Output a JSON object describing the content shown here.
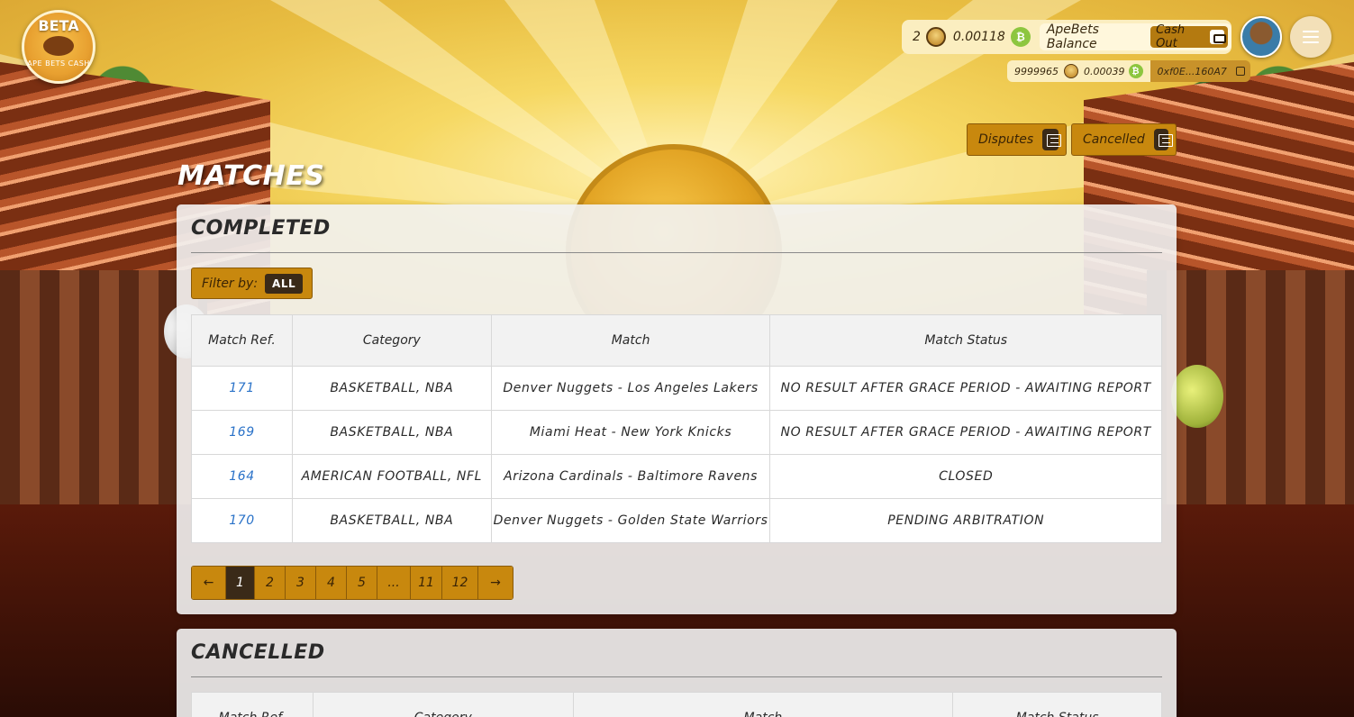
{
  "logo": {
    "beta": "BETA",
    "name": "APE BETS CASH"
  },
  "wallet": {
    "ape_count": "2",
    "btc_amount": "0.00118",
    "btc_glyph": "₿",
    "balance_label": "ApeBets Balance",
    "cashout_label": "Cash Out",
    "sub_ape_count": "9999965",
    "sub_btc_amount": "0.00039",
    "address": "0xf0E...160A7"
  },
  "actions": {
    "disputes": "Disputes",
    "cancelled": "Cancelled"
  },
  "page": {
    "title": "MATCHES"
  },
  "completed": {
    "title": "COMPLETED",
    "filter_label": "Filter by:",
    "filter_value": "ALL",
    "columns": [
      "Match Ref.",
      "Category",
      "Match",
      "Match Status"
    ],
    "rows": [
      {
        "ref": "171",
        "category": "BASKETBALL, NBA",
        "match": "Denver Nuggets  -  Los Angeles Lakers",
        "status": "NO RESULT AFTER GRACE PERIOD - AWAITING REPORT"
      },
      {
        "ref": "169",
        "category": "BASKETBALL, NBA",
        "match": "Miami Heat  -  New York Knicks",
        "status": "NO RESULT AFTER GRACE PERIOD - AWAITING REPORT"
      },
      {
        "ref": "164",
        "category": "AMERICAN FOOTBALL, NFL",
        "match": "Arizona Cardinals  -  Baltimore Ravens",
        "status": "CLOSED"
      },
      {
        "ref": "170",
        "category": "BASKETBALL, NBA",
        "match": "Denver Nuggets  -  Golden State Warriors",
        "status": "PENDING ARBITRATION"
      }
    ],
    "pagination": [
      "←",
      "1",
      "2",
      "3",
      "4",
      "5",
      "...",
      "11",
      "12",
      "→"
    ],
    "active_page": "1"
  },
  "cancelled": {
    "title": "CANCELLED",
    "columns": [
      "Match Ref.",
      "Category",
      "Match",
      "Match Status"
    ]
  },
  "colors": {
    "accent": "#c8880e",
    "dark": "#3a2a18",
    "link": "#2a72c8",
    "btc": "#8dc63f"
  }
}
